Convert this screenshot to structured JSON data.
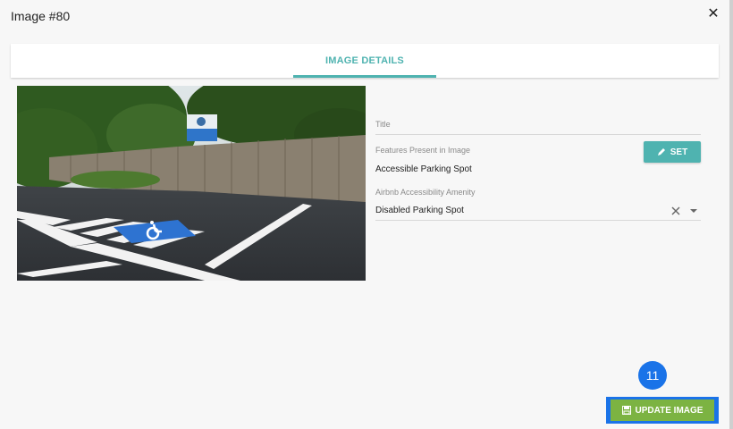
{
  "dialog": {
    "title": "Image #80",
    "close_icon": "close-icon"
  },
  "tabs": [
    {
      "label": "IMAGE DETAILS",
      "active": true
    }
  ],
  "form": {
    "title_label": "Title",
    "title_value": "",
    "features_label": "Features Present in Image",
    "features_value": "Accessible Parking Spot",
    "set_button_label": "SET",
    "amenity_label": "Airbnb Accessibility Amenity",
    "amenity_value": "Disabled Parking Spot"
  },
  "footer": {
    "step_number": "11",
    "update_button_label": "UPDATE IMAGE"
  },
  "colors": {
    "accent": "#4fb3b0",
    "update": "#7cb342",
    "highlight": "#1a73e8"
  }
}
